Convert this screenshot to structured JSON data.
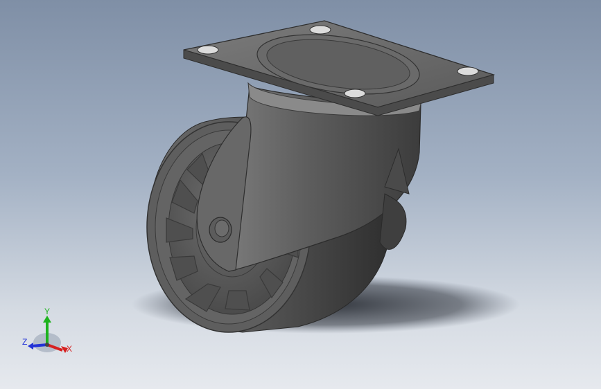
{
  "viewport": {
    "background_top": "#7f8fa6",
    "background_bottom": "#e6e9ee",
    "model": "caster-wheel"
  },
  "triad": {
    "x_label": "X",
    "y_label": "Y",
    "z_label": "Z",
    "x_color": "#d61f1f",
    "y_color": "#1db31d",
    "z_color": "#2333d6"
  }
}
